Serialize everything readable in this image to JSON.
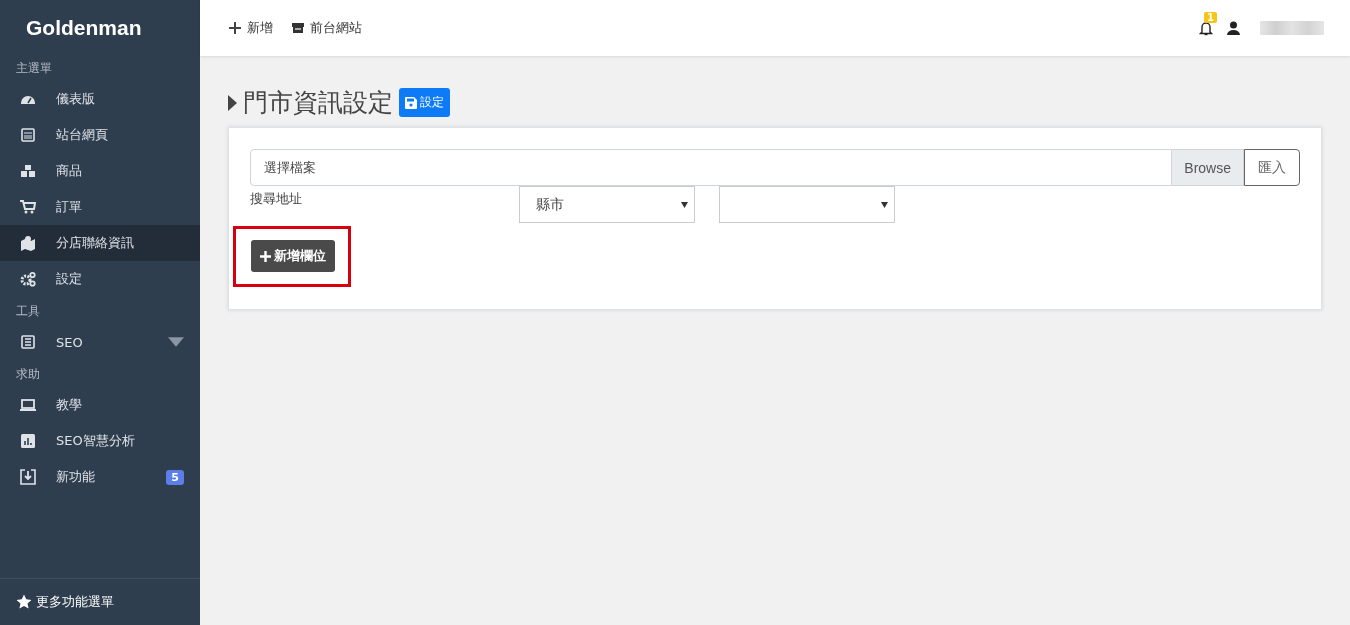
{
  "sidebar": {
    "brand": "Goldenman",
    "sections": [
      {
        "header": "主選單",
        "items": [
          {
            "label": "儀表版",
            "selected": false
          },
          {
            "label": "站台網頁",
            "selected": false
          },
          {
            "label": "商品",
            "selected": false
          },
          {
            "label": "訂單",
            "selected": false
          },
          {
            "label": "分店聯絡資訊",
            "selected": true
          },
          {
            "label": "設定",
            "selected": false
          }
        ]
      },
      {
        "header": "工具",
        "items": [
          {
            "label": "SEO",
            "selected": false,
            "expandable": true
          }
        ]
      },
      {
        "header": "求助",
        "items": [
          {
            "label": "教學",
            "selected": false
          },
          {
            "label": "SEO智慧分析",
            "selected": false
          },
          {
            "label": "新功能",
            "selected": false,
            "badge": "5"
          }
        ]
      }
    ],
    "footer": "更多功能選單"
  },
  "topbar": {
    "links": [
      "新增",
      "前台網站"
    ],
    "notification_count": "1"
  },
  "page": {
    "title": "門市資訊設定",
    "save_button": "設定",
    "file_input": {
      "placeholder": "選擇檔案",
      "browse": "Browse",
      "import_button": "匯入"
    },
    "address_label": "搜尋地址",
    "selects": [
      {
        "kind": "filled",
        "value": "縣市"
      },
      {
        "kind": "blank"
      }
    ],
    "add_button": "新增欄位",
    "add_button_highlighted": true
  }
}
